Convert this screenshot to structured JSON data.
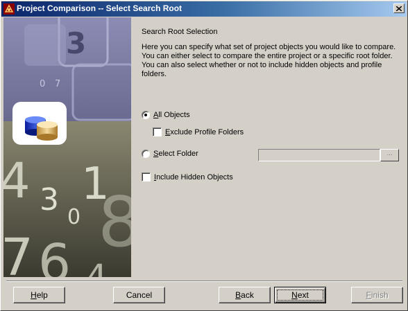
{
  "window": {
    "title": "Project Comparison -- Select Search Root"
  },
  "banner": {
    "digits": [
      "3",
      "0",
      "7",
      "4",
      "3",
      "1",
      "8",
      "0",
      "7",
      "6",
      "4"
    ]
  },
  "content": {
    "heading": "Search Root Selection",
    "description": "Here you can specify what set of project objects you would like to compare. You can either select to compare the entire project or a specific root folder. You can also select whether or not to include hidden objects and profile folders.",
    "options": {
      "all_objects": {
        "label_prefix": "",
        "label_hot": "A",
        "label_rest": "ll Objects",
        "checked": true
      },
      "exclude_profile": {
        "label_prefix": "",
        "label_hot": "E",
        "label_rest": "xclude Profile Folders",
        "checked": false
      },
      "select_folder": {
        "label_prefix": "",
        "label_hot": "S",
        "label_rest": "elect Folder",
        "checked": false
      },
      "include_hidden": {
        "label_prefix": "",
        "label_hot": "I",
        "label_rest": "nclude Hidden Objects",
        "checked": false
      }
    },
    "folder_field": {
      "value": ""
    },
    "browse_label": "..."
  },
  "buttons": {
    "help": {
      "hot": "H",
      "rest": "elp"
    },
    "cancel": {
      "label": "Cancel"
    },
    "back": {
      "hot": "B",
      "rest": "ack"
    },
    "next": {
      "hot": "N",
      "rest": "ext"
    },
    "finish": {
      "hot": "F",
      "rest": "inish"
    }
  },
  "colors": {
    "titlebar_start": "#0a246a",
    "titlebar_end": "#a6caf0",
    "dialog_face": "#d4d0c8"
  }
}
